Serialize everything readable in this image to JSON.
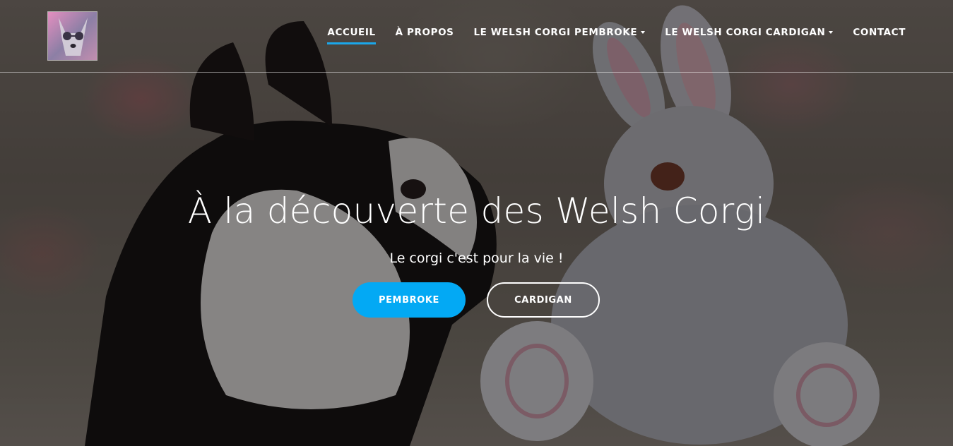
{
  "header": {
    "logo_icon": "corgi-logo-icon",
    "nav": [
      {
        "label": "ACCUEIL",
        "active": true,
        "dropdown": false
      },
      {
        "label": "À PROPOS",
        "active": false,
        "dropdown": false
      },
      {
        "label": "LE WELSH CORGI PEMBROKE",
        "active": false,
        "dropdown": true
      },
      {
        "label": "LE WELSH CORGI CARDIGAN",
        "active": false,
        "dropdown": true
      },
      {
        "label": "CONTACT",
        "active": false,
        "dropdown": false
      }
    ]
  },
  "hero": {
    "title": "À la découverte des Welsh Corgi",
    "subtitle": "Le corgi c'est pour la vie !",
    "primary_button": "PEMBROKE",
    "secondary_button": "CARDIGAN"
  },
  "colors": {
    "accent": "#03a9f4",
    "active_underline": "#1ba7ea",
    "text": "#ffffff"
  }
}
